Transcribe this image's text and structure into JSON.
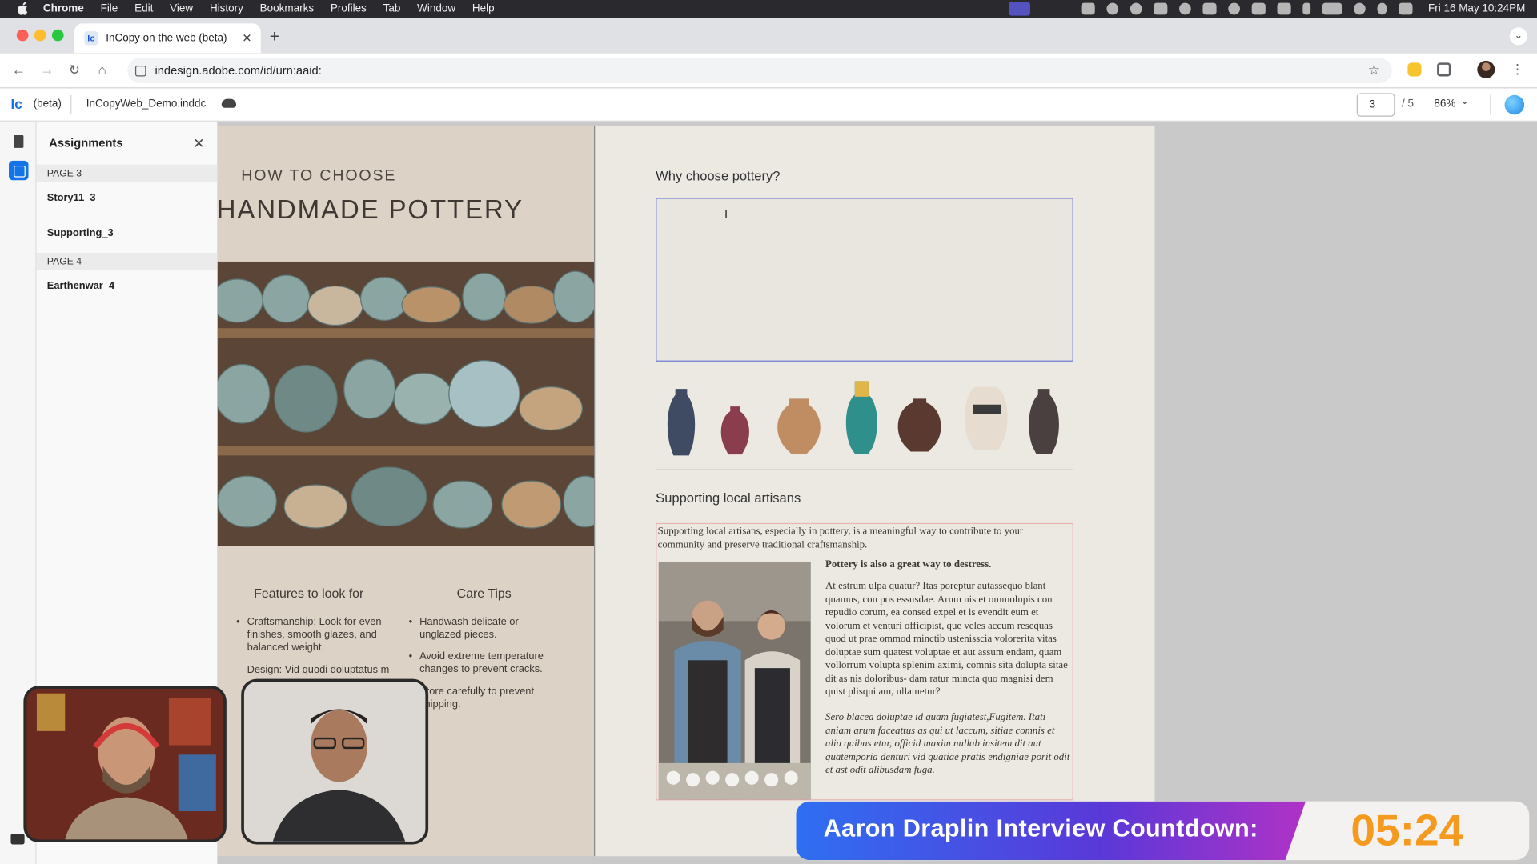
{
  "menubar": {
    "app": "Chrome",
    "items": [
      "File",
      "Edit",
      "View",
      "History",
      "Bookmarks",
      "Profiles",
      "Tab",
      "Window",
      "Help"
    ],
    "clock": "Fri 16 May  10:24PM"
  },
  "browser": {
    "tab_title": "InCopy on the web (beta)",
    "tab_favicon": "Ic",
    "url": "indesign.adobe.com/id/urn:aaid:"
  },
  "app": {
    "logo": "Ic",
    "beta": "(beta)",
    "document": "InCopyWeb_Demo.inddc",
    "page_current": "3",
    "page_total": "/ 5",
    "zoom": "86%"
  },
  "assignments": {
    "title": "Assignments",
    "close": "✕",
    "sections": [
      {
        "heading": "PAGE 3",
        "items": [
          "Story11_3",
          "Supporting_3"
        ]
      },
      {
        "heading": "PAGE 4",
        "items": [
          "Earthenwar_4"
        ]
      }
    ]
  },
  "page_left": {
    "kicker": "HOW TO CHOOSE",
    "title": "HANDMADE POTTERY",
    "features": {
      "heading": "Features to look for",
      "bullets": [
        "Craftsmanship: Look for even finishes, smooth glazes, and balanced weight.",
        "Design: Vid quodi doluptatus m"
      ]
    },
    "care": {
      "heading": "Care Tips",
      "bullets": [
        "Handwash delicate or unglazed pieces.",
        "Avoid extreme temperature changes to prevent cracks.",
        "Store carefully to prevent chipping."
      ]
    }
  },
  "page_right": {
    "question": "Why choose pottery?",
    "subheading": "Supporting local artisans",
    "intro": "Supporting local artisans, especially in pottery, is a meaningful way to contribute to your community and preserve traditional craftsmanship.",
    "bold_line": "Pottery is also a great way to destress.",
    "para2": "At estrum ulpa quatur? Itas poreptur autassequo blant quamus, con pos essusdae. Arum nis et ommolupis con repudio corum, ea consed expel et is evendit eum et volorum et venturi officipist, que veles accum resequas quod ut prae ommod minctib ustenisscia volorerita vitas doluptae sum quatest voluptae et aut assum endam, quam vollorrum volupta splenim aximi, comnis sita dolupta sitae dit as nis doloribus- dam ratur mincta quo magnisi dem quist plisqui am, ullametur?",
    "para3": "Sero blacea doluptae id quam fugiatest,Fugitem. Itati aniam arum faceattus as qui ut laccum, sitiae comnis et alia quibus etur, officid maxim nullab insitem dit aut quatemporia denturi vid quatiae pratis endigniae porit odit et ast odit alibusdam fuga."
  },
  "overlay": {
    "countdown_label": "Aaron Draplin Interview Countdown:",
    "countdown_time": "05:24"
  },
  "colors": {
    "accent": "#1473e6",
    "countdown_orange": "#f39a1f",
    "selection_frame": "#6c7bd0"
  }
}
